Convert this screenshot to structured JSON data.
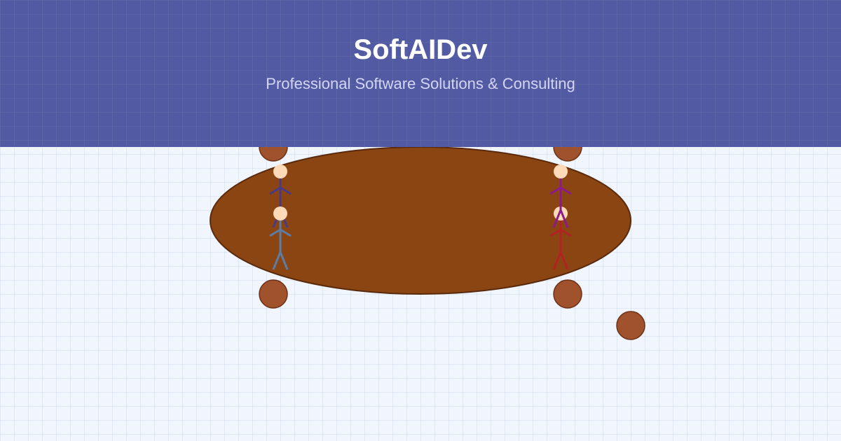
{
  "header": {
    "brand": "SoftAIDev",
    "tagline": "Professional Software Solutions & Consulting",
    "band_color": "#525aa3",
    "brand_color": "#ffffff",
    "tagline_color": "#d3d5f5"
  },
  "scene": {
    "table_color": "#8b4513",
    "table_outline_color": "#5a2a0c",
    "chair_color": "#a0522d",
    "chair_outline_color": "#6b3115",
    "skin_color": "#ffdab9",
    "figure_colors": [
      "#4a3a86",
      "#5c7ea6",
      "#8b1a8b",
      "#b22222"
    ]
  }
}
